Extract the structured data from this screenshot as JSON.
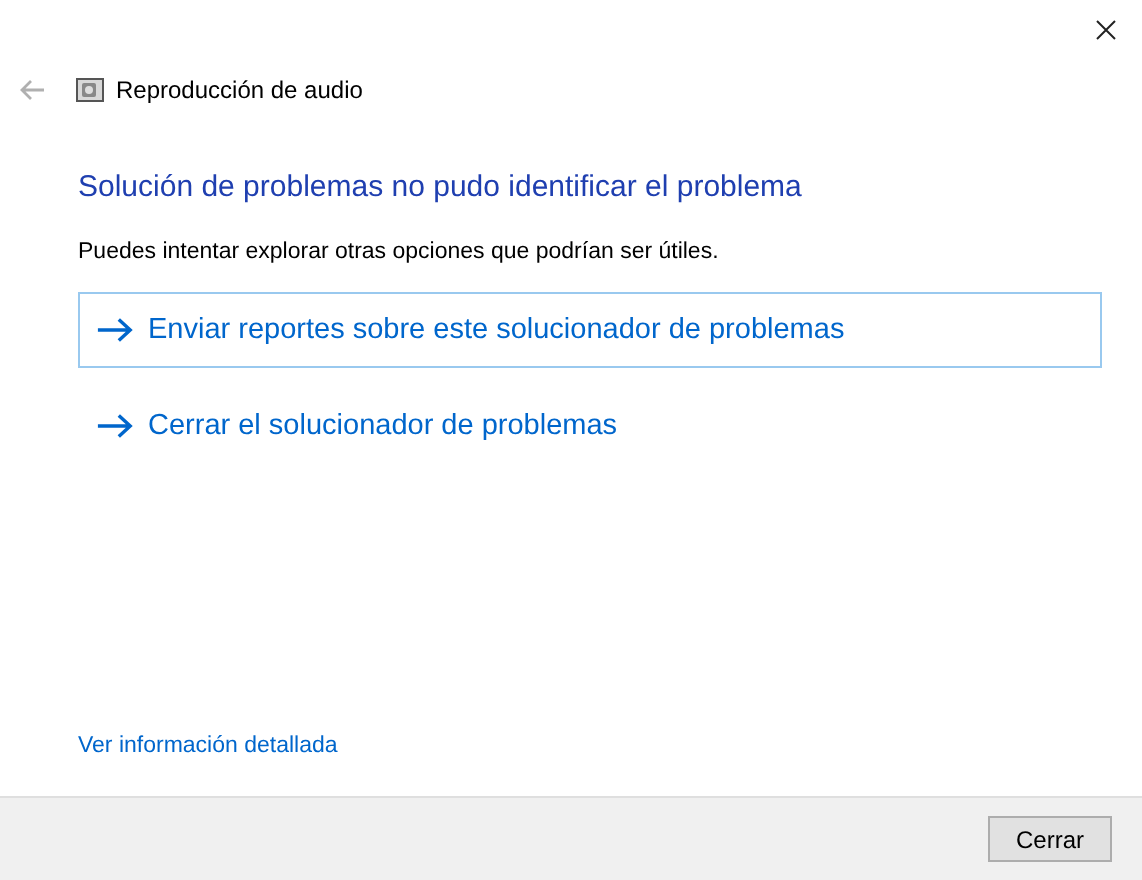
{
  "header": {
    "title": "Reproducción de audio"
  },
  "heading": "Solución de problemas no pudo identificar el problema",
  "description": "Puedes intentar explorar otras opciones que podrían ser útiles.",
  "options": [
    {
      "label": "Enviar reportes sobre este solucionador de problemas",
      "selected": true
    },
    {
      "label": "Cerrar el solucionador de problemas",
      "selected": false
    }
  ],
  "details_link": "Ver información detallada",
  "buttons": [
    {
      "label": "Cerrar"
    }
  ]
}
